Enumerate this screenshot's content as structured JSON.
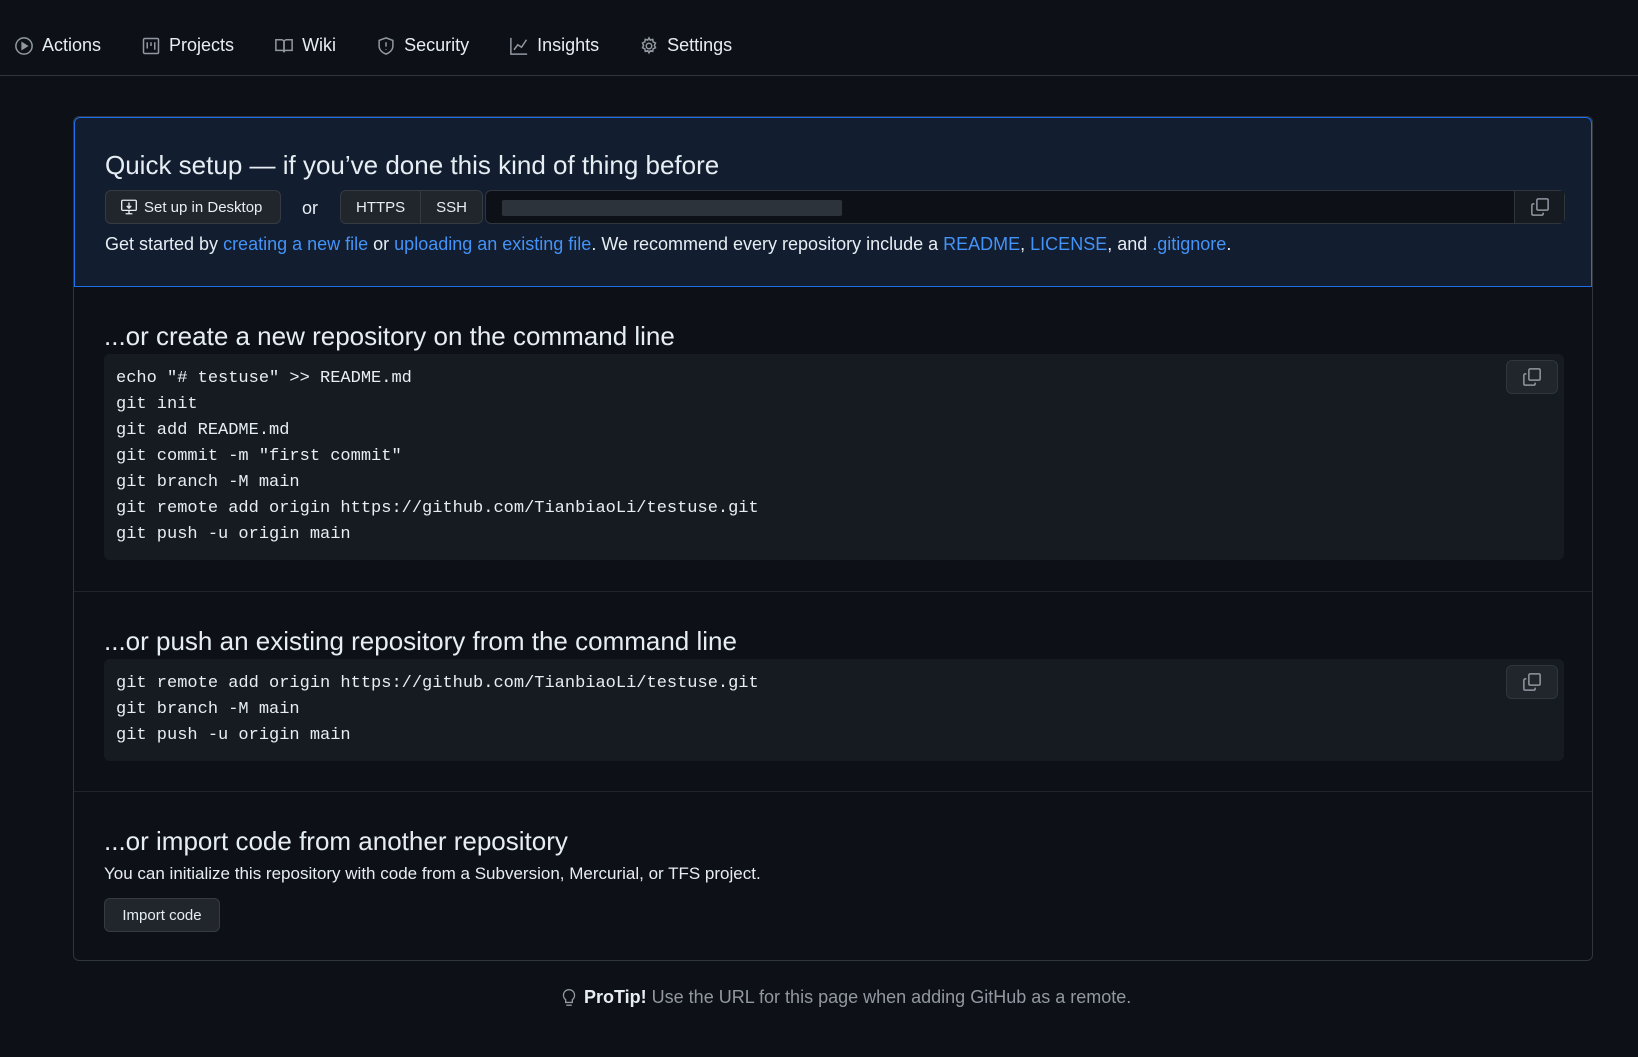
{
  "nav": {
    "items": [
      {
        "label": "Actions",
        "icon": "play-circle-icon"
      },
      {
        "label": "Projects",
        "icon": "table-icon"
      },
      {
        "label": "Wiki",
        "icon": "book-icon"
      },
      {
        "label": "Security",
        "icon": "shield-icon"
      },
      {
        "label": "Insights",
        "icon": "graph-icon"
      },
      {
        "label": "Settings",
        "icon": "gear-icon"
      }
    ]
  },
  "quick": {
    "title": "Quick setup — if you’ve done this kind of thing before",
    "desktop_label": "Set up in Desktop",
    "or": "or",
    "https": "HTTPS",
    "ssh": "SSH",
    "gs_prefix": "Get started by ",
    "gs_link1": "creating a new file",
    "gs_or": " or ",
    "gs_link2": "uploading an existing file",
    "gs_mid": ". We recommend every repository include a ",
    "gs_readme": "README",
    "gs_comma": ", ",
    "gs_license": "LICENSE",
    "gs_and": ", and ",
    "gs_gitignore": ".gitignore",
    "gs_end": "."
  },
  "create": {
    "title": "...or create a new repository on the command line",
    "lines": [
      "echo \"# testuse\" >> README.md",
      "git init",
      "git add README.md",
      "git commit -m \"first commit\"",
      "git branch -M main",
      "git remote add origin https://github.com/TianbiaoLi/testuse.git",
      "git push -u origin main"
    ]
  },
  "push": {
    "title": "...or push an existing repository from the command line",
    "lines": [
      "git remote add origin https://github.com/TianbiaoLi/testuse.git",
      "git branch -M main",
      "git push -u origin main"
    ]
  },
  "import": {
    "title": "...or import code from another repository",
    "desc": "You can initialize this repository with code from a Subversion, Mercurial, or TFS project.",
    "button": "Import code"
  },
  "protip": {
    "label": "ProTip!",
    "text": " Use the URL for this page when adding GitHub as a remote."
  }
}
